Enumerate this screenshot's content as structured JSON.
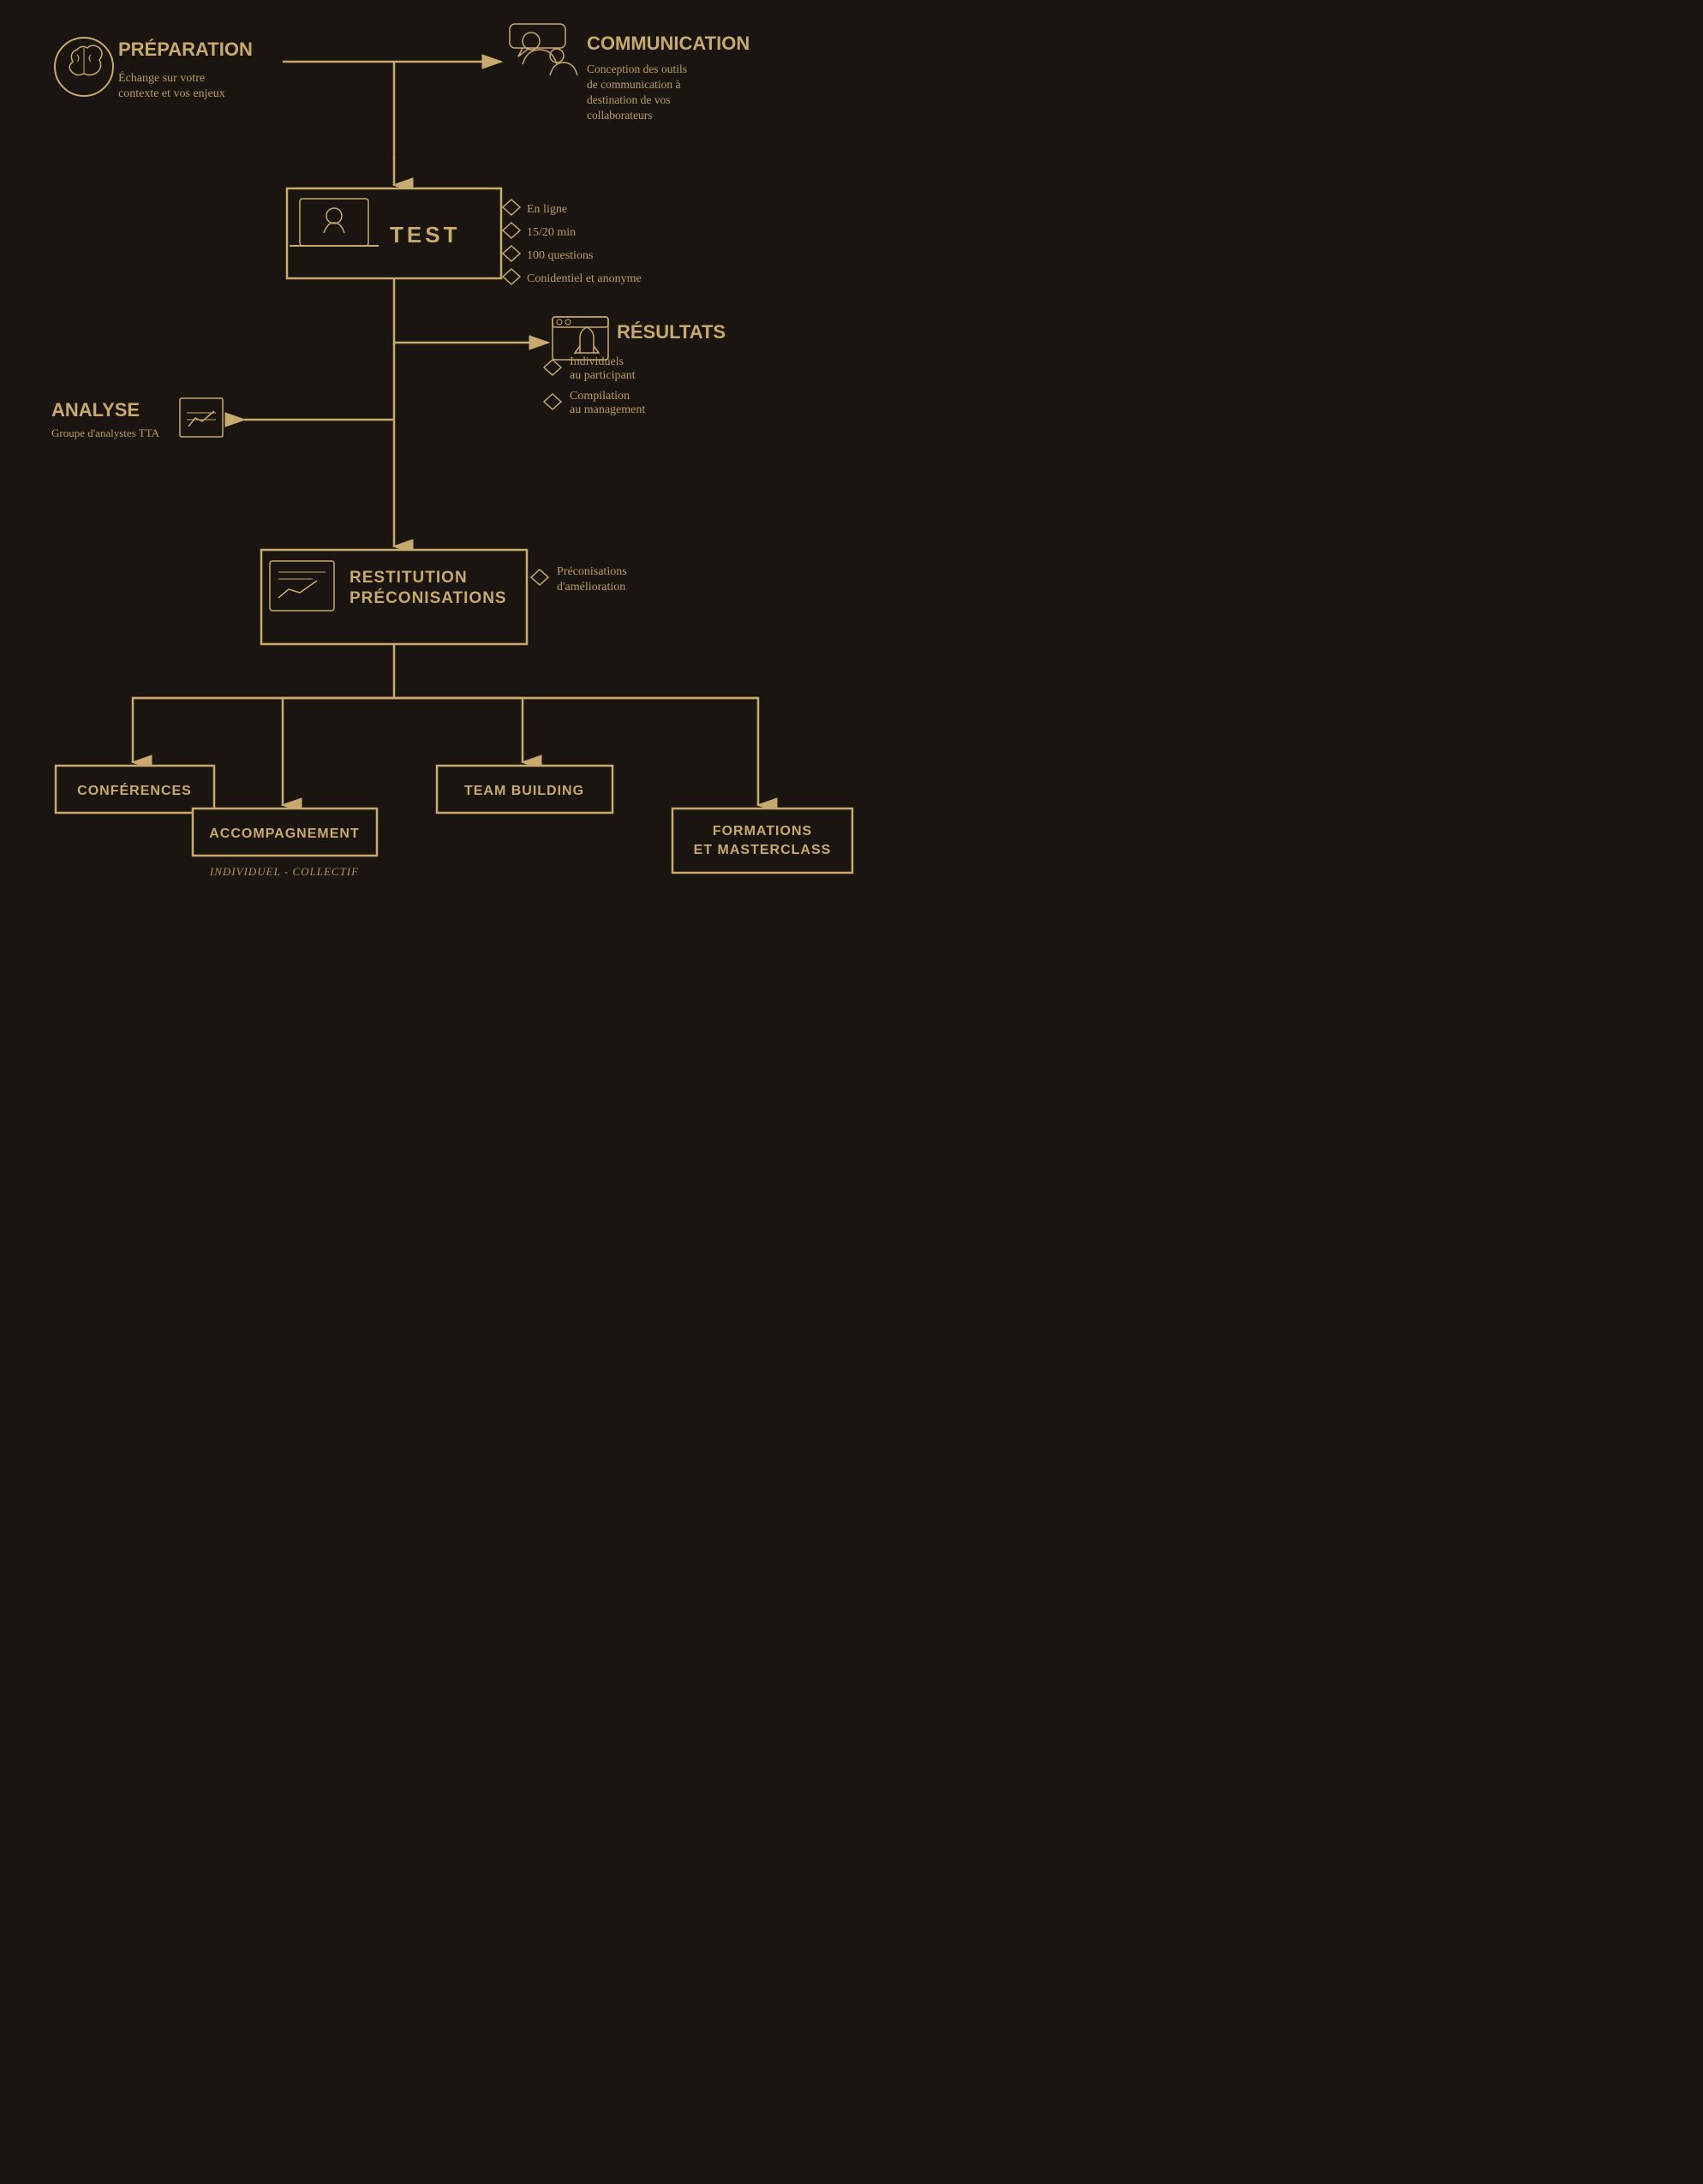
{
  "colors": {
    "bg": "#1a1510",
    "accent": "#c8a96e",
    "text": "#c8a96e"
  },
  "preparation": {
    "title": "PRÉPARATION",
    "text_line1": "Échange sur votre",
    "text_line2": "contexte et vos enjeux"
  },
  "communication": {
    "title": "COMMUNICATION",
    "text": "Conception des outils de communication à destination de vos collaborateurs"
  },
  "test": {
    "label": "TEST",
    "details": [
      "En ligne",
      "15/20 min",
      "100 questions",
      "Conidentiel et anonyme"
    ]
  },
  "resultats": {
    "title": "RÉSULTATS",
    "items": [
      "Individuels au participant",
      "Compilation au management"
    ]
  },
  "analyse": {
    "title": "ANALYSE",
    "subtitle": "Groupe d'analystes TTA"
  },
  "restitution": {
    "label_line1": "RESTITUTION",
    "label_line2": "PRÉCONISATIONS",
    "detail": "Préconisations d'amélioration"
  },
  "bottom": {
    "conferences": "CONFÉRENCES",
    "accompagnement": "ACCOMPAGNEMENT",
    "team_building": "TEAM BUILDING",
    "formations": "FORMATIONS ET MASTERCLASS",
    "individuel": "INDIVIDUEL - COLLECTIF"
  }
}
